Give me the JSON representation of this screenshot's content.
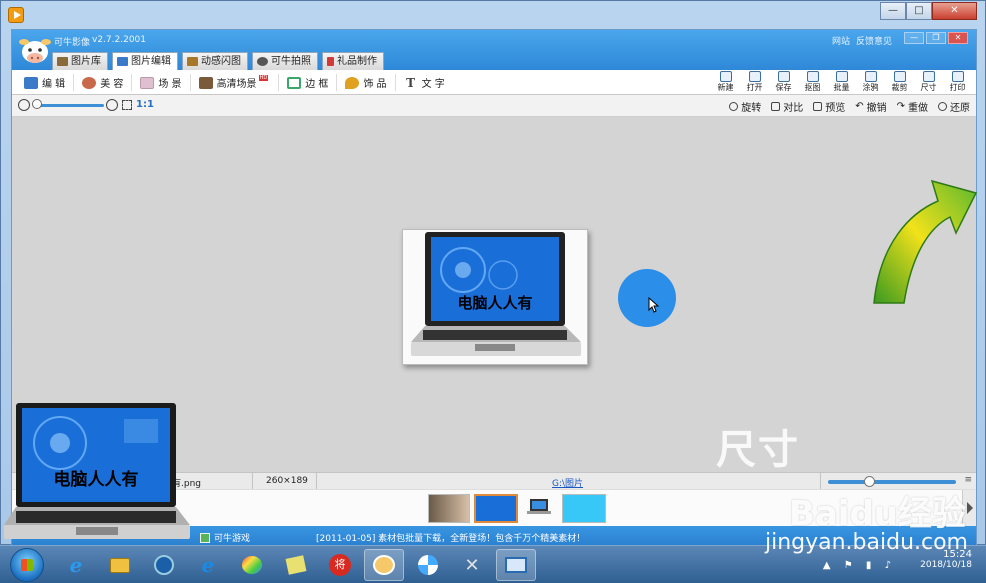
{
  "app": {
    "name": "可牛影像",
    "version": "v2.7.2.2001",
    "top_links": [
      "网站",
      "反馈意见"
    ]
  },
  "main_tabs": [
    {
      "label": "图片库",
      "icon": "gallery-icon",
      "color": "#8a6a3a"
    },
    {
      "label": "图片编辑",
      "icon": "image-edit-icon",
      "color": "#3a7ac8"
    },
    {
      "label": "动感闪图",
      "icon": "film-icon",
      "color": "#a8782a"
    },
    {
      "label": "可牛拍照",
      "icon": "camera-icon",
      "color": "#555555"
    },
    {
      "label": "礼品制作",
      "icon": "gift-icon",
      "color": "#d23a3a"
    }
  ],
  "edit_tools": [
    {
      "label": "编 辑",
      "icon": "edit-icon",
      "color": "#3a7ac8"
    },
    {
      "label": "美 容",
      "icon": "face-icon",
      "color": "#c86a4a"
    },
    {
      "label": "场 景",
      "icon": "scene-icon",
      "color": "#e0c0d0"
    },
    {
      "label": "高清场景",
      "icon": "hd-scene-icon",
      "color": "#7a5a3a",
      "badge": "HD"
    },
    {
      "label": "边 框",
      "icon": "frame-icon",
      "color": "#3aa86a"
    },
    {
      "label": "饰 品",
      "icon": "clover-icon",
      "color": "#e0a020"
    },
    {
      "label": "文 字",
      "icon": "text-icon",
      "color": "#444444"
    }
  ],
  "action_tools": [
    {
      "label": "新建",
      "icon": "new-file-icon"
    },
    {
      "label": "打开",
      "icon": "open-folder-icon"
    },
    {
      "label": "保存",
      "icon": "save-icon"
    },
    {
      "label": "抠图",
      "icon": "cutout-icon"
    },
    {
      "label": "批量",
      "icon": "batch-icon"
    },
    {
      "label": "涂鸦",
      "icon": "doodle-icon"
    },
    {
      "label": "裁剪",
      "icon": "crop-icon"
    },
    {
      "label": "尺寸",
      "icon": "resize-icon"
    },
    {
      "label": "打印",
      "icon": "print-icon"
    }
  ],
  "zoom": {
    "level": "1:1",
    "slider_fraction": 0.0
  },
  "view_tools": [
    {
      "label": "旋转",
      "icon": "rotate-icon"
    },
    {
      "label": "对比",
      "icon": "compare-icon"
    },
    {
      "label": "预览",
      "icon": "preview-icon"
    },
    {
      "label": "撤销",
      "icon": "undo-icon"
    },
    {
      "label": "重做",
      "icon": "redo-icon"
    },
    {
      "label": "还原",
      "icon": "restore-icon"
    }
  ],
  "photo": {
    "caption": "电脑人人有"
  },
  "overlay_text": {
    "size_label": "尺寸"
  },
  "status": {
    "file_name": "有.png",
    "dimensions": "260×189",
    "folder": "G:\\图片"
  },
  "bottom_bar": {
    "game_link": "可牛游戏",
    "news": "[2011-01-05] 素材包批量下载，全新登场！包含千万个精美素材！"
  },
  "taskbar": {
    "time": "15:24",
    "date": "2018/10/18"
  },
  "watermark": {
    "brand": "Baidu经验",
    "url": "jingyan.baidu.com"
  },
  "colors": {
    "accent": "#2e88d8",
    "pointer": "#2b8ee8",
    "arrow_green": "#5cb82e",
    "arrow_yellow": "#f4e01a"
  }
}
